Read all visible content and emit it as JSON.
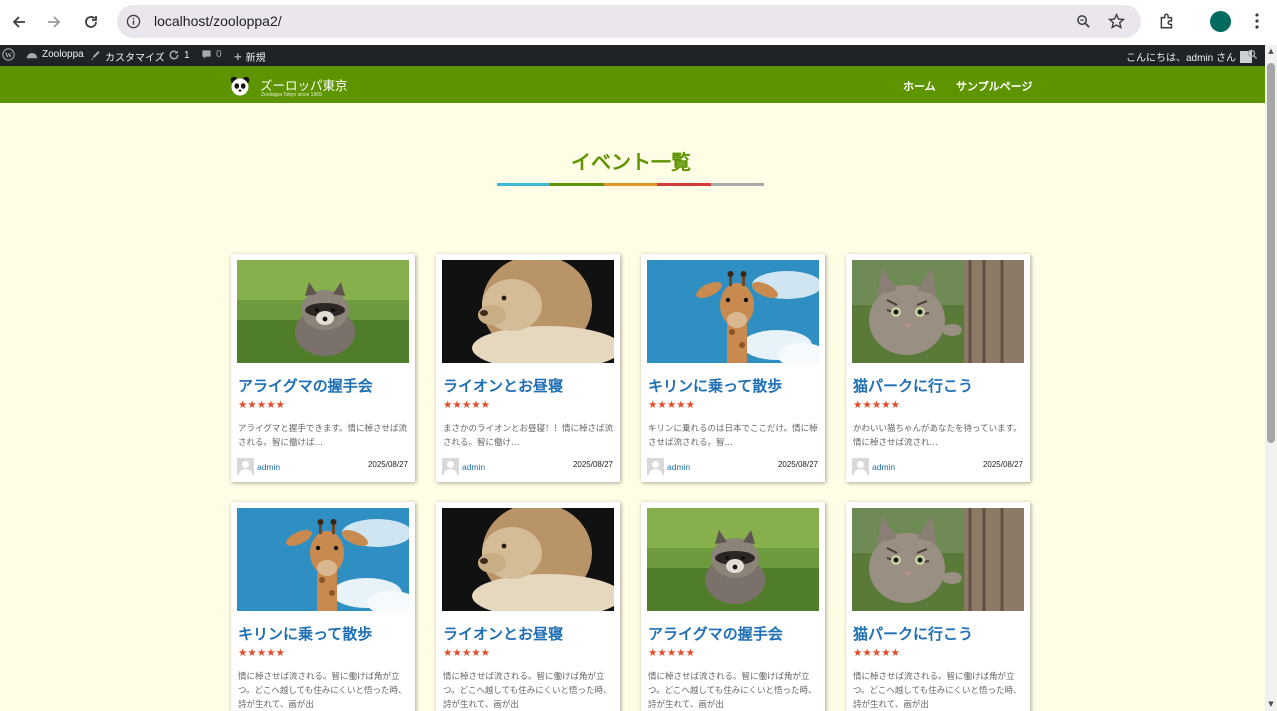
{
  "browser": {
    "url": "localhost/zooloppa2/",
    "colors": {
      "omnibox_bg": "#ebe6ee",
      "profile": "#006b5e"
    }
  },
  "admin_bar": {
    "site_name": "Zooloppa",
    "customize": "カスタマイズ",
    "updates_count": "1",
    "comments_count": "0",
    "new_label": "新規",
    "greeting": "こんにちは、admin さん"
  },
  "site": {
    "title": "ズーロッパ東京",
    "tagline": "Zooloppa Tokyo since 1969",
    "menu": [
      "ホーム",
      "サンプルページ"
    ],
    "colors": {
      "header": "#5e9400",
      "main_bg": "#fffde5",
      "link": "#1e6fb3",
      "stars": "#e24a28"
    }
  },
  "page": {
    "title": "イベント一覧",
    "underline_colors": [
      "#3cb9d0",
      "#5e9400",
      "#e0952a",
      "#d23c3c",
      "#a8a8a8"
    ]
  },
  "events": [
    {
      "title": "アライグマの握手会",
      "stars": "★★★★★",
      "excerpt": "アライグマと握手できます。情に棹させば流される。智に働けば…",
      "author": "admin",
      "date": "2025/08/27",
      "image": "raccoon"
    },
    {
      "title": "ライオンとお昼寝",
      "stars": "★★★★★",
      "excerpt": "まさかのライオンとお昼寝！！情に棹さば流される。智に働け…",
      "author": "admin",
      "date": "2025/08/27",
      "image": "lion"
    },
    {
      "title": "キリンに乗って散歩",
      "stars": "★★★★★",
      "excerpt": "キリンに乗れるのは日本でここだけ。情に棹させば流される。智…",
      "author": "admin",
      "date": "2025/08/27",
      "image": "giraffe"
    },
    {
      "title": "猫パークに行こう",
      "stars": "★★★★★",
      "excerpt": "かわいい猫ちゃんがあなたを待っています。情に棹させば流され…",
      "author": "admin",
      "date": "2025/08/27",
      "image": "cat"
    },
    {
      "title": "キリンに乗って散歩",
      "stars": "★★★★★",
      "excerpt": "情に棹させば流される。智に働けば角が立つ。どこへ越しても住みにくいと悟った時、詩が生れて、画が出",
      "author": "",
      "date": "",
      "image": "giraffe"
    },
    {
      "title": "ライオンとお昼寝",
      "stars": "★★★★★",
      "excerpt": "情に棹させば流される。智に働けば角が立つ。どこへ越しても住みにくいと悟った時、詩が生れて、画が出",
      "author": "",
      "date": "",
      "image": "lion"
    },
    {
      "title": "アライグマの握手会",
      "stars": "★★★★★",
      "excerpt": "情に棹させば流される。智に働けば角が立つ。どこへ越しても住みにくいと悟った時、詩が生れて、画が出",
      "author": "",
      "date": "",
      "image": "raccoon"
    },
    {
      "title": "猫パークに行こう",
      "stars": "★★★★★",
      "excerpt": "情に棹させば流される。智に働けば角が立つ。どこへ越しても住みにくいと悟った時、詩が生れて、画が出",
      "author": "",
      "date": "",
      "image": "cat"
    }
  ]
}
